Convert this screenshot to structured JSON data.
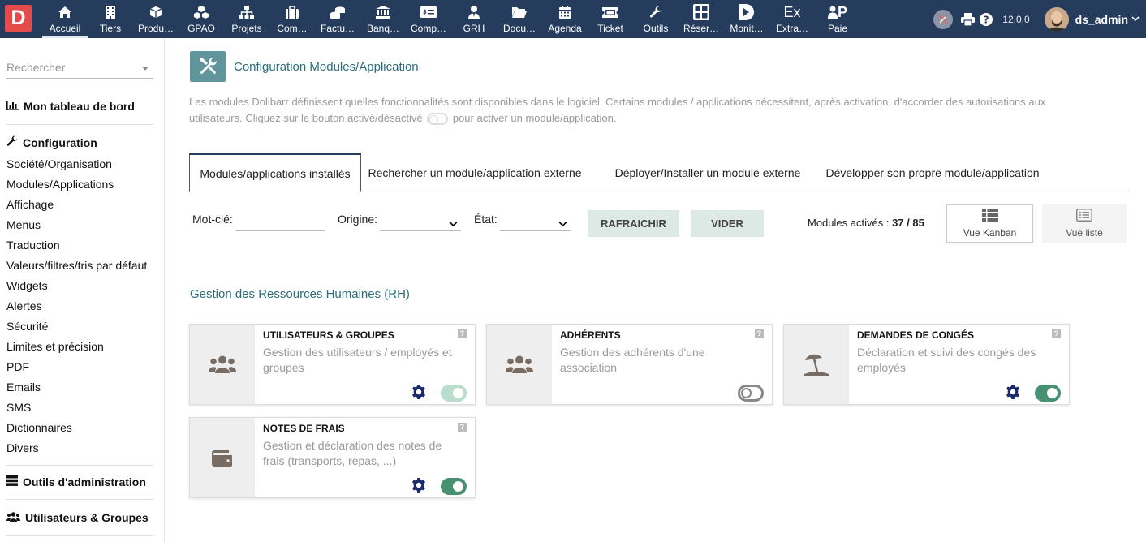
{
  "app": {
    "logo_letter": "D",
    "version": "12.0.0",
    "username": "ds_admin"
  },
  "menu": [
    {
      "label": "Accueil",
      "icon": "home-icon"
    },
    {
      "label": "Tiers",
      "icon": "building-icon"
    },
    {
      "label": "Produ…",
      "icon": "cube-icon"
    },
    {
      "label": "GPAO",
      "icon": "cubes-icon"
    },
    {
      "label": "Projets",
      "icon": "sitemap-icon"
    },
    {
      "label": "Com…",
      "icon": "suitcase-icon"
    },
    {
      "label": "Factu…",
      "icon": "coins-icon"
    },
    {
      "label": "Banq…",
      "icon": "bank-icon"
    },
    {
      "label": "Comp…",
      "icon": "money-check-icon"
    },
    {
      "label": "GRH",
      "icon": "user-tie-icon"
    },
    {
      "label": "Docu…",
      "icon": "folder-icon"
    },
    {
      "label": "Agenda",
      "icon": "calendar-icon"
    },
    {
      "label": "Ticket",
      "icon": "ticket-icon"
    },
    {
      "label": "Outils",
      "icon": "wrench-icon"
    },
    {
      "label": "Réser…",
      "icon": "grid-icon"
    },
    {
      "label": "Monit…",
      "icon": "play-icon"
    },
    {
      "label": "Extra…",
      "icon": "ex-text-icon",
      "icon_text": "Ex"
    },
    {
      "label": "Paie",
      "icon": "user-p-icon",
      "icon_text": "P"
    }
  ],
  "sidebar": {
    "search_placeholder": "Rechercher",
    "dashboard": "Mon tableau de bord",
    "configuration": "Configuration",
    "links": [
      "Société/Organisation",
      "Modules/Applications",
      "Affichage",
      "Menus",
      "Traduction",
      "Valeurs/filtres/tris par défaut",
      "Widgets",
      "Alertes",
      "Sécurité",
      "Limites et précision",
      "PDF",
      "Emails",
      "SMS",
      "Dictionnaires",
      "Divers"
    ],
    "admin_tools": "Outils d'administration",
    "users_groups": "Utilisateurs & Groupes"
  },
  "page": {
    "title": "Configuration Modules/Application",
    "description_1": "Les modules Dolibarr définissent quelles fonctionnalités sont disponibles dans le logiciel. Certains modules / applications nécessitent, après activation, d'accorder des autorisations aux",
    "description_2a": "utilisateurs. Cliquez sur le bouton activé/désactivé",
    "description_2b": "pour activer un module/application."
  },
  "tabs": [
    "Modules/applications installés",
    "Rechercher un module/application externe",
    "Déployer/Installer un module externe",
    "Développer son propre module/application"
  ],
  "filters": {
    "keyword_label": "Mot-clé:",
    "keyword_value": "",
    "origin_label": "Origine:",
    "origin_value": "",
    "state_label": "État:",
    "state_value": "",
    "refresh_button": "RAFRAICHIR",
    "clear_button": "VIDER",
    "count_label": "Modules activés :",
    "count_active": "37",
    "count_sep": "/",
    "count_total": "85",
    "kanban_label": "Vue Kanban",
    "list_label": "Vue liste"
  },
  "section": {
    "title": "Gestion des Ressources Humaines (RH)"
  },
  "modules": [
    {
      "title": "UTILISATEURS & GROUPES",
      "description": "Gestion des utilisateurs / employés et groupes",
      "icon": "users-icon",
      "enabled": true,
      "has_setup": true
    },
    {
      "title": "ADHÉRENTS",
      "description": "Gestion des adhérents d'une association",
      "icon": "users-icon",
      "enabled": false,
      "has_setup": false
    },
    {
      "title": "DEMANDES DE CONGÉS",
      "description": "Déclaration et suivi des congés des employés",
      "icon": "umbrella-beach-icon",
      "enabled": true,
      "has_setup": true
    },
    {
      "title": "NOTES DE FRAIS",
      "description": "Gestion et déclaration des notes de frais (transports, repas, ...)",
      "icon": "wallet-icon",
      "enabled": true,
      "has_setup": true
    }
  ],
  "colors": {
    "topbar": "#263c5c",
    "accent": "#2b6d7d",
    "toggle_on": "#479071",
    "logo": "#e54b4b"
  }
}
